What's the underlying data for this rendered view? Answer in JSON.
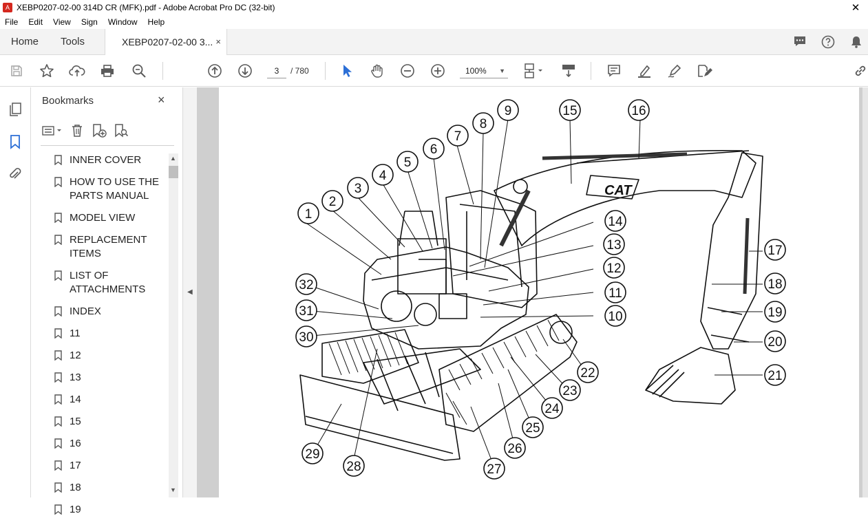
{
  "window": {
    "title": "XEBP0207-02-00 314D CR (MFK).pdf - Adobe Acrobat Pro DC (32-bit)",
    "app_icon": "acrobat-icon"
  },
  "menu": [
    "File",
    "Edit",
    "View",
    "Sign",
    "Window",
    "Help"
  ],
  "tabs": {
    "home": "Home",
    "tools": "Tools",
    "document": "XEBP0207-02-00 3...",
    "close": "×"
  },
  "toolbar": {
    "page_current": "3",
    "page_total": "/ 780",
    "zoom": "100%"
  },
  "bookmarks": {
    "title": "Bookmarks",
    "close": "×",
    "items": [
      "INNER COVER",
      "HOW TO USE THE PARTS MANUAL",
      "MODEL VIEW",
      "REPLACEMENT ITEMS",
      "LIST OF ATTACHMENTS",
      "INDEX",
      "11",
      "12",
      "13",
      "14",
      "15",
      "16",
      "17",
      "18",
      "19"
    ]
  },
  "diagram": {
    "brand_label": "CAT",
    "callouts": [
      "1",
      "2",
      "3",
      "4",
      "5",
      "6",
      "7",
      "8",
      "9",
      "10",
      "11",
      "12",
      "13",
      "14",
      "15",
      "16",
      "17",
      "18",
      "19",
      "20",
      "21",
      "22",
      "23",
      "24",
      "25",
      "26",
      "27",
      "28",
      "29",
      "30",
      "31",
      "32"
    ]
  },
  "colors": {
    "accent": "#2c6fd6",
    "icon": "#5a5a5a",
    "chrome": "#f3f3f3",
    "viewer_bg": "#cfcfcf",
    "title_icon": "#d4281f"
  }
}
